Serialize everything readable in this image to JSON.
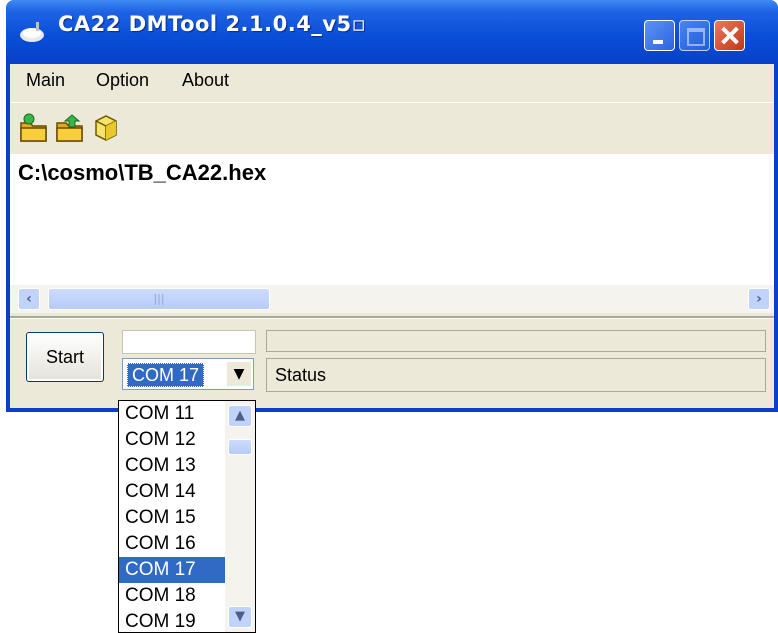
{
  "window": {
    "title": "CA22 DMTool 2.1.0.4_v5▫"
  },
  "menu": {
    "items": [
      "Main",
      "Option",
      "About"
    ]
  },
  "toolbar": {
    "tools": [
      "open-folder-icon",
      "open-folder-arrow-icon",
      "cube-icon"
    ]
  },
  "editor": {
    "path": "C:\\cosmo\\TB_CA22.hex"
  },
  "controls": {
    "start_label": "Start",
    "com_selected": "COM 17",
    "status_text": "Status"
  },
  "dropdown": {
    "options": [
      "COM 11",
      "COM 12",
      "COM 13",
      "COM 14",
      "COM 15",
      "COM 16",
      "COM 17",
      "COM 18",
      "COM 19"
    ],
    "selected_index": 6
  },
  "colors": {
    "titlebar": "#0a4fd8",
    "selection": "#316ac5",
    "face": "#ece9d8"
  }
}
